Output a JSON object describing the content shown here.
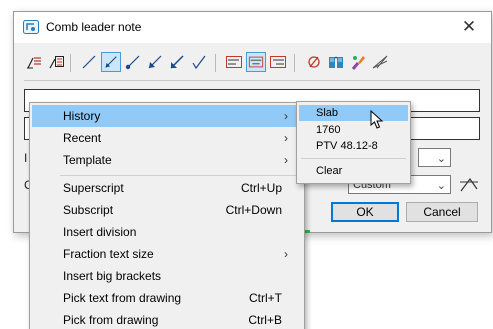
{
  "window": {
    "title": "Comb leader note",
    "close_glyph": "✕"
  },
  "toolbar": {
    "buttons": [
      {
        "icon": "leader-text-left-icon"
      },
      {
        "icon": "leader-text-frame-icon"
      },
      {
        "icon": "line-straight-icon"
      },
      {
        "icon": "line-arrow-dot-icon",
        "active": true
      },
      {
        "icon": "line-dot-icon"
      },
      {
        "icon": "line-arrow-icon"
      },
      {
        "icon": "line-arrow-bold-icon"
      },
      {
        "icon": "line-check-icon"
      },
      {
        "icon": "align-left-icon"
      },
      {
        "icon": "align-center-icon",
        "active": true
      },
      {
        "icon": "align-right-icon"
      },
      {
        "icon": "no-symbol-icon"
      },
      {
        "icon": "book-icon"
      },
      {
        "icon": "paint-brush-icon"
      },
      {
        "icon": "angle-tool-icon"
      }
    ]
  },
  "form": {
    "label_i": "I",
    "label_c": "C",
    "custom_combo": "Custom",
    "ok_label": "OK",
    "cancel_label": "Cancel"
  },
  "context_menu": {
    "items": [
      {
        "label": "History",
        "submenu": true,
        "highlight": true
      },
      {
        "label": "Recent",
        "submenu": true
      },
      {
        "label": "Template",
        "submenu": true
      },
      {
        "separator": true
      },
      {
        "label": "Superscript",
        "shortcut": "Ctrl+Up"
      },
      {
        "label": "Subscript",
        "shortcut": "Ctrl+Down"
      },
      {
        "label": "Insert division"
      },
      {
        "label": "Fraction text size",
        "submenu": true
      },
      {
        "label": "Insert big brackets"
      },
      {
        "label": "Pick text from drawing",
        "shortcut": "Ctrl+T"
      },
      {
        "label": "Pick from drawing",
        "shortcut": "Ctrl+B"
      }
    ]
  },
  "history_submenu": {
    "items": [
      {
        "label": "Slab",
        "highlight": true
      },
      {
        "label": "1760"
      },
      {
        "label": "PTV 48.12-8"
      },
      {
        "separator": true
      },
      {
        "label": "Clear"
      }
    ]
  },
  "colors": {
    "highlight": "#91c9f7",
    "accent": "#0078d7",
    "active_tool": "#cde6f7"
  }
}
